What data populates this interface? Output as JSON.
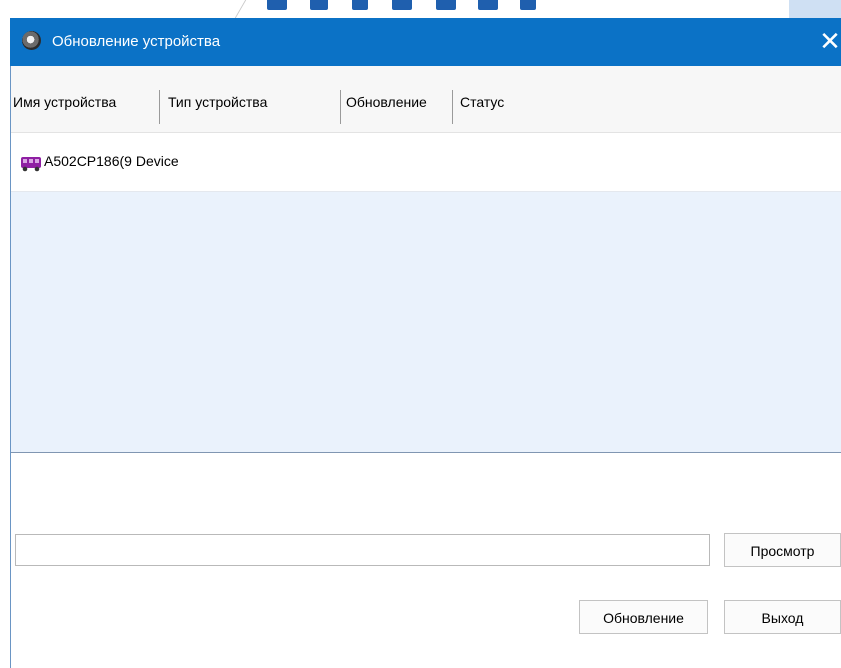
{
  "window": {
    "title": "Обновление устройства",
    "close_glyph": "✕",
    "titlebar_color": "#0b72c6"
  },
  "list": {
    "columns": [
      {
        "label": "Имя устройства"
      },
      {
        "label": "Тип устройства"
      },
      {
        "label": "Обновление"
      },
      {
        "label": "Статус"
      }
    ],
    "rows": [
      {
        "icon": "bus-icon",
        "name": "А502СР186(9 Device",
        "type": "",
        "update": "",
        "status": ""
      }
    ],
    "icon_color": "#8f1fa3"
  },
  "path_field": {
    "value": "",
    "placeholder": ""
  },
  "buttons": {
    "browse": "Просмотр",
    "update": "Обновление",
    "exit": "Выход"
  }
}
